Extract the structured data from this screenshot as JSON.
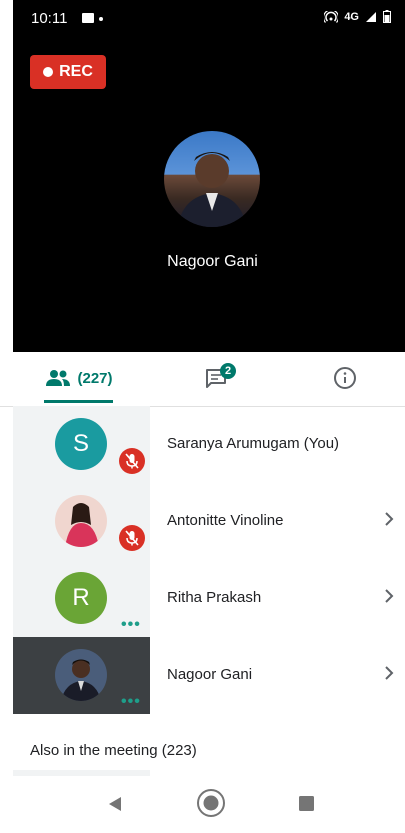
{
  "status_bar": {
    "time": "10:11",
    "network": "4G"
  },
  "recording": {
    "label": "REC"
  },
  "speaker": {
    "name": "Nagoor Gani"
  },
  "tabs": {
    "people_count": "(227)",
    "chat_badge": "2"
  },
  "participants": [
    {
      "name": "Saranya Arumugam (You)",
      "initial": "S",
      "avatar_color": "#1a9ba0",
      "muted": true,
      "has_chevron": false
    },
    {
      "name": "Antonitte Vinoline",
      "initial": "",
      "avatar_color": "#e6b3a8",
      "muted": true,
      "has_chevron": true
    },
    {
      "name": "Ritha Prakash",
      "initial": "R",
      "avatar_color": "#6aa536",
      "muted": false,
      "has_chevron": true
    },
    {
      "name": "Nagoor Gani",
      "initial": "",
      "avatar_color": "#4a5d7a",
      "muted": false,
      "has_chevron": true
    }
  ],
  "also_in_meeting": "Also in the meeting (223)",
  "colors": {
    "accent": "#00796b",
    "rec": "#d93025",
    "muted": "#d93025"
  }
}
